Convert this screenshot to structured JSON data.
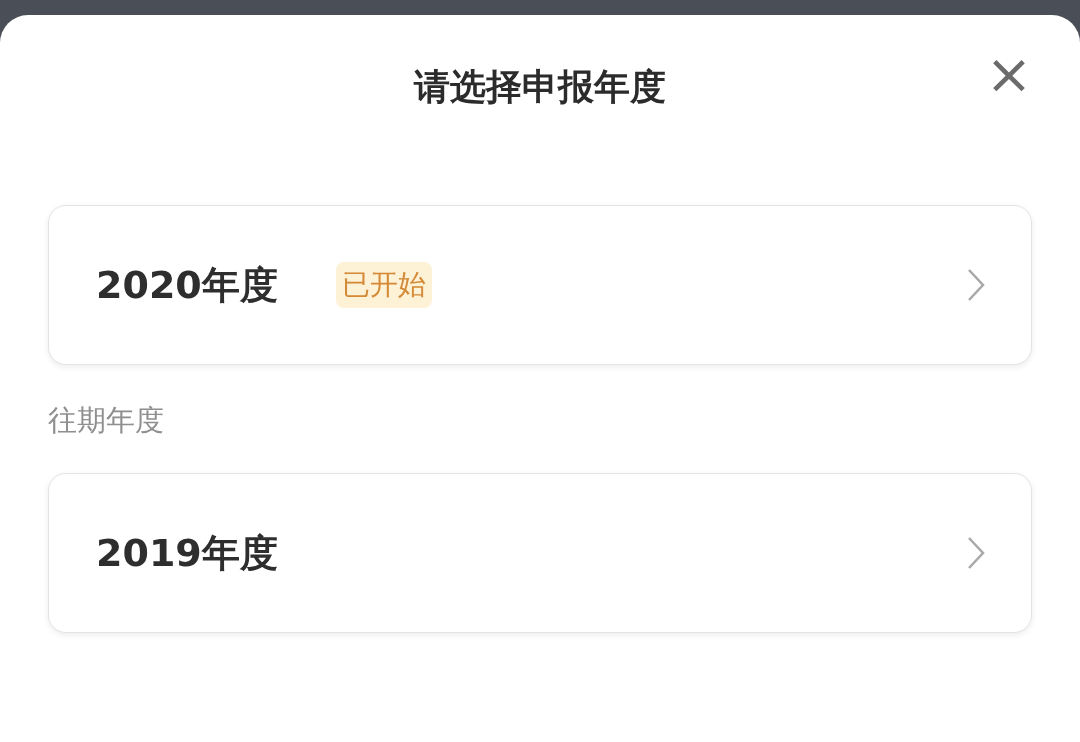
{
  "sheet": {
    "title": "请选择申报年度",
    "close_label": "×"
  },
  "current": [
    {
      "label": "2020年度",
      "badge": "已开始"
    }
  ],
  "past_heading": "往期年度",
  "past": [
    {
      "label": "2019年度"
    }
  ]
}
